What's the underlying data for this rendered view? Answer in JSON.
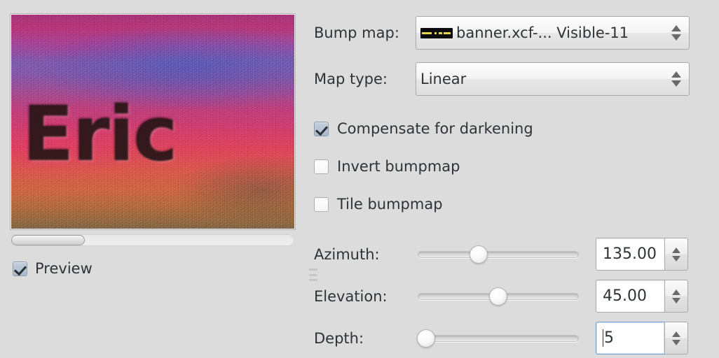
{
  "left": {
    "preview": {
      "image_text": "Eric",
      "alt_name": "bumpmapped-noise-preview"
    },
    "scrollbar": {
      "name": "preview-horizontal-scrollbar"
    },
    "preview_checkbox": {
      "label": "Preview",
      "checked": true
    }
  },
  "right": {
    "bump_map": {
      "label": "Bump map:",
      "value": "banner.xcf-... Visible-11",
      "thumbnail": "layer-thumbnail-icon"
    },
    "map_type": {
      "label": "Map type:",
      "value": "Linear"
    },
    "checkboxes": [
      {
        "label": "Compensate for darkening",
        "checked": true
      },
      {
        "label": "Invert bumpmap",
        "checked": false
      },
      {
        "label": "Tile bumpmap",
        "checked": false
      }
    ],
    "sliders": [
      {
        "label": "Azimuth:",
        "value": "135.00",
        "fill_percent": 38,
        "focused": false
      },
      {
        "label": "Elevation:",
        "value": "45.00",
        "fill_percent": 50,
        "focused": false
      },
      {
        "label": "Depth:",
        "value": "5",
        "fill_percent": 5,
        "focused": true
      }
    ]
  },
  "colors": {
    "background": "#dcdcdc",
    "text": "#2e3436",
    "focus_border": "#7ba2c8",
    "checkbox_on": "#a9bacb"
  }
}
